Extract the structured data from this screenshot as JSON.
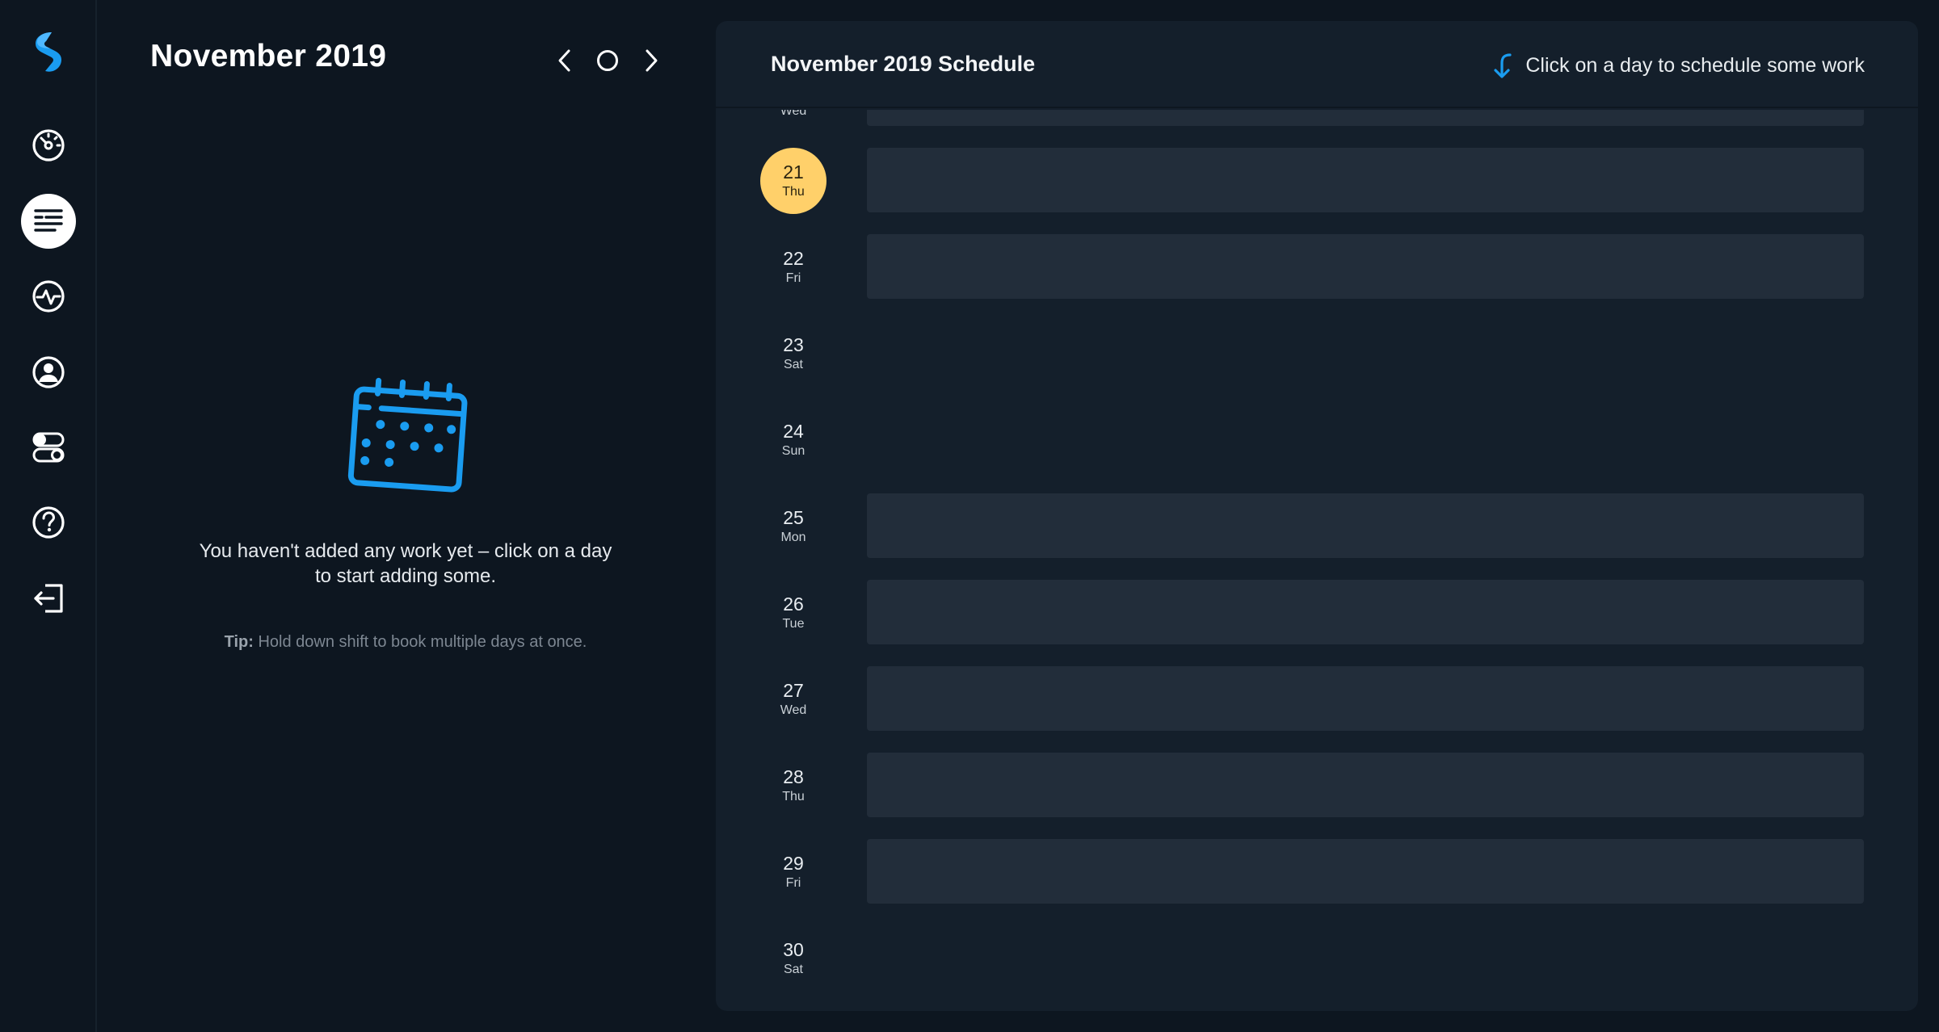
{
  "colors": {
    "background": "#0d1620",
    "panel": "#141f2b",
    "day_bar": "#222d3a",
    "accent_blue": "#1a9cf0",
    "today_highlight": "#ffd06a"
  },
  "sidebar": {
    "items": [
      {
        "name": "dashboard",
        "icon": "gauge-icon",
        "active": false
      },
      {
        "name": "schedule",
        "icon": "list-icon",
        "active": true
      },
      {
        "name": "activity",
        "icon": "pulse-icon",
        "active": false
      },
      {
        "name": "profile",
        "icon": "user-circle-icon",
        "active": false
      },
      {
        "name": "settings",
        "icon": "toggles-icon",
        "active": false
      },
      {
        "name": "help",
        "icon": "question-icon",
        "active": false
      },
      {
        "name": "logout",
        "icon": "logout-icon",
        "active": false
      }
    ]
  },
  "left": {
    "title": "November 2019",
    "empty_message": "You haven't added any work yet – click on a day to start adding some.",
    "tip_label": "Tip:",
    "tip_text": "Hold down shift to book multiple days at once."
  },
  "schedule": {
    "title": "November 2019 Schedule",
    "hint": "Click on a day to schedule some work",
    "days": [
      {
        "num": "",
        "dow": "Wed",
        "today": false,
        "weekday": true
      },
      {
        "num": "21",
        "dow": "Thu",
        "today": true,
        "weekday": true
      },
      {
        "num": "22",
        "dow": "Fri",
        "today": false,
        "weekday": true
      },
      {
        "num": "23",
        "dow": "Sat",
        "today": false,
        "weekday": false
      },
      {
        "num": "24",
        "dow": "Sun",
        "today": false,
        "weekday": false
      },
      {
        "num": "25",
        "dow": "Mon",
        "today": false,
        "weekday": true
      },
      {
        "num": "26",
        "dow": "Tue",
        "today": false,
        "weekday": true
      },
      {
        "num": "27",
        "dow": "Wed",
        "today": false,
        "weekday": true
      },
      {
        "num": "28",
        "dow": "Thu",
        "today": false,
        "weekday": true
      },
      {
        "num": "29",
        "dow": "Fri",
        "today": false,
        "weekday": true
      },
      {
        "num": "30",
        "dow": "Sat",
        "today": false,
        "weekday": false
      }
    ]
  }
}
